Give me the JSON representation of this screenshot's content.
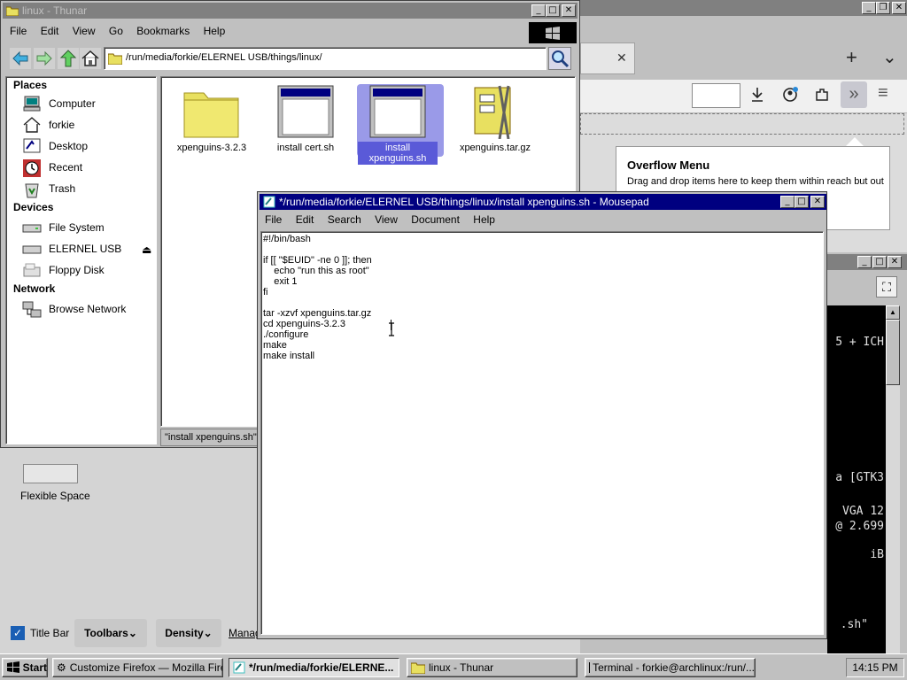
{
  "firefox": {
    "overflow_title": "Overflow Menu",
    "overflow_desc": "Drag and drop items here to keep them within reach but out",
    "new_tab": "+",
    "tab_close": "✕",
    "list_tabs": "⌄",
    "overflow_chevron": "»",
    "menu": "≡",
    "flexible_space": "Flexible Space",
    "title_bar_label": "Title Bar",
    "toolbars_label": "Toolbars",
    "density_label": "Density",
    "manage_label": "Manag"
  },
  "terminal": {
    "lines": [
      "5 + ICH",
      "a [GTK3",
      "VGA 12",
      "@ 2.699",
      "iB",
      ".sh\""
    ]
  },
  "thunar": {
    "title": "linux - Thunar",
    "menu": [
      "File",
      "Edit",
      "View",
      "Go",
      "Bookmarks",
      "Help"
    ],
    "path": "/run/media/forkie/ELERNEL USB/things/linux/",
    "places_header": "Places",
    "places": [
      "Computer",
      "forkie",
      "Desktop",
      "Recent",
      "Trash"
    ],
    "devices_header": "Devices",
    "devices": [
      "File System",
      "ELERNEL USB",
      "Floppy Disk"
    ],
    "network_header": "Network",
    "network": [
      "Browse Network"
    ],
    "files": [
      "xpenguins-3.2.3",
      "install cert.sh",
      "install xpenguins.sh",
      "xpenguins.tar.gz"
    ],
    "status": "\"install xpenguins.sh\""
  },
  "mousepad": {
    "title": "*/run/media/forkie/ELERNEL USB/things/linux/install xpenguins.sh - Mousepad",
    "menu": [
      "File",
      "Edit",
      "Search",
      "View",
      "Document",
      "Help"
    ],
    "content": "#!/bin/bash\n\nif [[ \"$EUID\" -ne 0 ]]; then\n    echo \"run this as root\"\n    exit 1\nfi\n\ntar -xzvf xpenguins.tar.gz\ncd xpenguins-3.2.3\n./configure\nmake\nmake install"
  },
  "taskbar": {
    "start": "Start",
    "items": [
      "Customize Firefox — Mozilla Firefox",
      "*/run/media/forkie/ELERNE...",
      "linux - Thunar",
      "Terminal - forkie@archlinux:/run/..."
    ],
    "clock": "14:15 PM"
  },
  "colors": {
    "titlebar_active": "#000080",
    "selection": "#5a5ad8",
    "folder": "#e8e060"
  }
}
